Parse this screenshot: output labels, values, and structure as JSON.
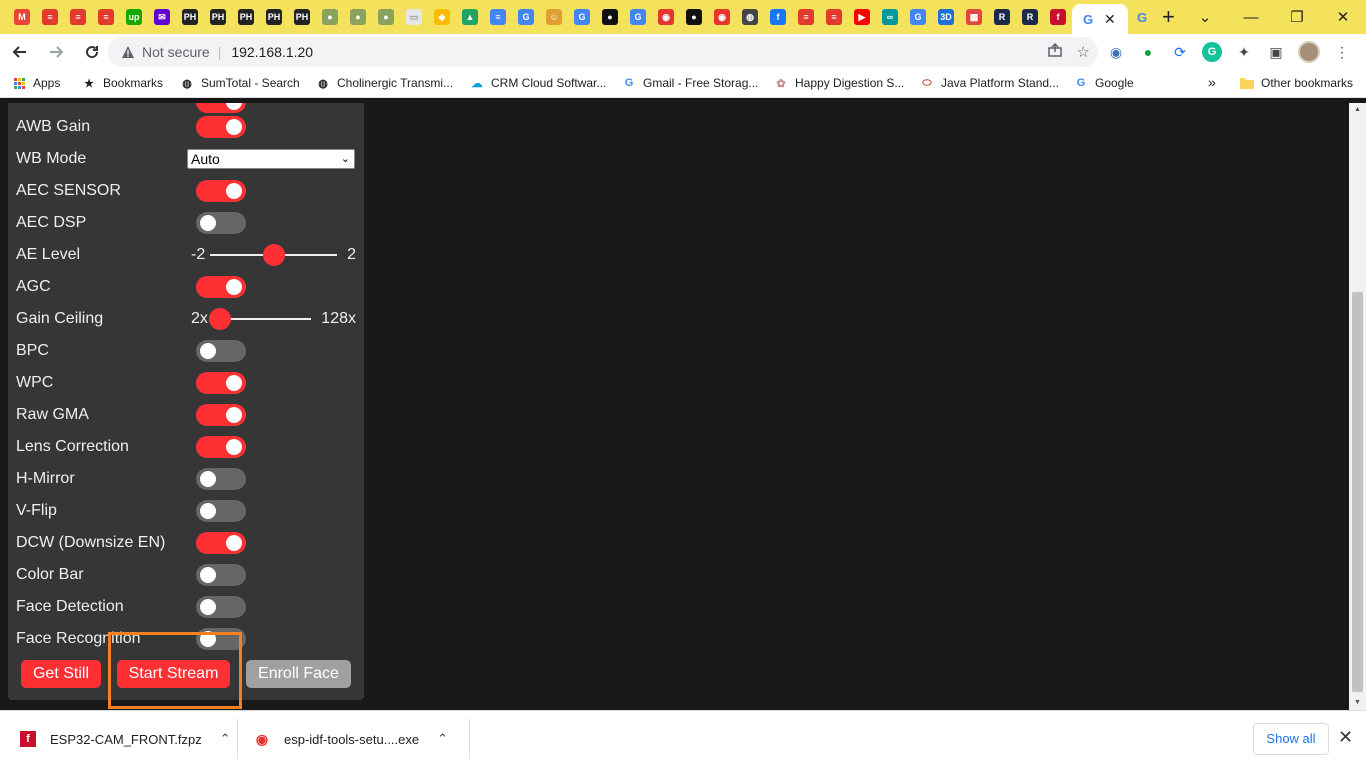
{
  "browser": {
    "pinned_tabs": [
      {
        "icon": "gmail-icon",
        "glyph": "M",
        "color": "#ea4335"
      },
      {
        "icon": "stripe-flag-icon",
        "glyph": "≡",
        "color": "#e23a2c"
      },
      {
        "icon": "stripe-flag-icon",
        "glyph": "≡",
        "color": "#e23a2c"
      },
      {
        "icon": "stripe-flag-icon",
        "glyph": "≡",
        "color": "#e23a2c"
      },
      {
        "icon": "upwork-icon",
        "glyph": "up",
        "color": "#14a800"
      },
      {
        "icon": "mail-icon",
        "glyph": "✉",
        "color": "#6001d2"
      },
      {
        "icon": "producthunt-icon",
        "glyph": "PH",
        "color": "#222222"
      },
      {
        "icon": "producthunt-icon",
        "glyph": "PH",
        "color": "#222222"
      },
      {
        "icon": "producthunt-icon",
        "glyph": "PH",
        "color": "#222222"
      },
      {
        "icon": "producthunt-icon",
        "glyph": "PH",
        "color": "#222222"
      },
      {
        "icon": "producthunt-icon",
        "glyph": "PH",
        "color": "#222222"
      },
      {
        "icon": "circle-badge-icon",
        "glyph": "●",
        "color": "#8aa35c"
      },
      {
        "icon": "circle-badge-icon",
        "glyph": "●",
        "color": "#8aa35c"
      },
      {
        "icon": "circle-badge-icon",
        "glyph": "●",
        "color": "#8aa35c"
      },
      {
        "icon": "document-icon",
        "glyph": "▭",
        "color": "#e6e6e6"
      },
      {
        "icon": "keep-icon",
        "glyph": "◆",
        "color": "#fbbc04"
      },
      {
        "icon": "drive-icon",
        "glyph": "▲",
        "color": "#1fa463"
      },
      {
        "icon": "docs-icon",
        "glyph": "≡",
        "color": "#4285f4"
      },
      {
        "icon": "google-icon",
        "glyph": "G",
        "color": "#4285f4"
      },
      {
        "icon": "avatar-icon",
        "glyph": "☺",
        "color": "#e0a030"
      },
      {
        "icon": "google-icon",
        "glyph": "G",
        "color": "#4285f4"
      },
      {
        "icon": "github-icon",
        "glyph": "●",
        "color": "#111111"
      },
      {
        "icon": "google-icon",
        "glyph": "G",
        "color": "#4285f4"
      },
      {
        "icon": "espressif-icon",
        "glyph": "◉",
        "color": "#e7352c"
      },
      {
        "icon": "github-icon",
        "glyph": "●",
        "color": "#111111"
      },
      {
        "icon": "espressif-icon",
        "glyph": "◉",
        "color": "#e7352c"
      },
      {
        "icon": "globe-icon",
        "glyph": "◍",
        "color": "#444444"
      },
      {
        "icon": "facebook-icon",
        "glyph": "f",
        "color": "#1877f2"
      },
      {
        "icon": "stripe-flag-icon",
        "glyph": "≡",
        "color": "#e23a2c"
      },
      {
        "icon": "stripe-flag-icon",
        "glyph": "≡",
        "color": "#e23a2c"
      },
      {
        "icon": "youtube-icon",
        "glyph": "▶",
        "color": "#ff0000"
      },
      {
        "icon": "arduino-icon",
        "glyph": "∞",
        "color": "#00979d"
      },
      {
        "icon": "google-icon",
        "glyph": "G",
        "color": "#4285f4"
      },
      {
        "icon": "3d-icon",
        "glyph": "3D",
        "color": "#1e6fd9"
      },
      {
        "icon": "grid-app-icon",
        "glyph": "▦",
        "color": "#e0483e"
      },
      {
        "icon": "r-letter-icon",
        "glyph": "R",
        "color": "#1b2a4a"
      },
      {
        "icon": "r-letter-icon",
        "glyph": "R",
        "color": "#1b2a4a"
      },
      {
        "icon": "fritzing-icon",
        "glyph": "f",
        "color": "#c8102e"
      }
    ],
    "active_tab": {
      "icon": "google-icon",
      "glyph": "G"
    },
    "new_tab_label": "+",
    "window_controls": [
      "⌄",
      "—",
      "❐",
      "✕"
    ],
    "address": {
      "security_label": "Not secure",
      "url": "192.168.1.20"
    },
    "bookmarks": [
      {
        "label": "Apps",
        "icon": "apps-grid-icon"
      },
      {
        "label": "Bookmarks",
        "icon": "star-icon"
      },
      {
        "label": "SumTotal - Search",
        "icon": "globe-icon"
      },
      {
        "label": "Cholinergic Transmi...",
        "icon": "globe-icon"
      },
      {
        "label": "CRM Cloud Softwar...",
        "icon": "salesforce-cloud-icon"
      },
      {
        "label": "Gmail - Free Storag...",
        "icon": "google-icon"
      },
      {
        "label": "Happy Digestion S...",
        "icon": "flower-icon"
      },
      {
        "label": "Java Platform Stand...",
        "icon": "oracle-icon"
      },
      {
        "label": "Google",
        "icon": "google-icon"
      }
    ],
    "bookmarks_overflow": "»",
    "other_bookmarks": "Other bookmarks"
  },
  "camera_panel": {
    "rows": [
      {
        "label": "AWB Gain",
        "type": "toggle",
        "on": true
      },
      {
        "label": "WB Mode",
        "type": "select",
        "value": "Auto"
      },
      {
        "label": "AEC SENSOR",
        "type": "toggle",
        "on": true
      },
      {
        "label": "AEC DSP",
        "type": "toggle",
        "on": false
      },
      {
        "label": "AE Level",
        "type": "range",
        "min_label": "-2",
        "max_label": "2",
        "value": 0
      },
      {
        "label": "AGC",
        "type": "toggle",
        "on": true
      },
      {
        "label": "Gain Ceiling",
        "type": "range",
        "min_label": "2x",
        "max_label": "128x",
        "value": 0
      },
      {
        "label": "BPC",
        "type": "toggle",
        "on": false
      },
      {
        "label": "WPC",
        "type": "toggle",
        "on": true
      },
      {
        "label": "Raw GMA",
        "type": "toggle",
        "on": true
      },
      {
        "label": "Lens Correction",
        "type": "toggle",
        "on": true
      },
      {
        "label": "H-Mirror",
        "type": "toggle",
        "on": false
      },
      {
        "label": "V-Flip",
        "type": "toggle",
        "on": false
      },
      {
        "label": "DCW (Downsize EN)",
        "type": "toggle",
        "on": true
      },
      {
        "label": "Color Bar",
        "type": "toggle",
        "on": false
      },
      {
        "label": "Face Detection",
        "type": "toggle",
        "on": false
      },
      {
        "label": "Face Recognition",
        "type": "toggle",
        "on": false
      }
    ],
    "buttons": {
      "get_still": "Get Still",
      "start_stream": "Start Stream",
      "enroll_face": "Enroll Face"
    },
    "accent_color": "#ff3034",
    "highlight_color": "#f58220"
  },
  "downloads": {
    "items": [
      {
        "name": "ESP32-CAM_FRONT.fzpz",
        "icon": "fritzing-icon"
      },
      {
        "name": "esp-idf-tools-setu....exe",
        "icon": "espressif-icon"
      }
    ],
    "show_all": "Show all"
  }
}
